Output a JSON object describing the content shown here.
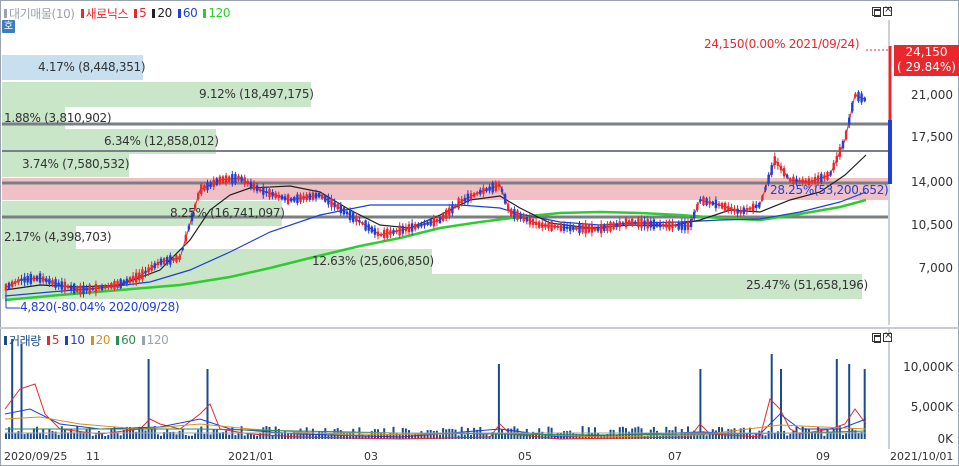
{
  "price_legend": {
    "items": [
      {
        "label": "대기매물(10)",
        "color": "#9aa3ad"
      },
      {
        "label": "새로닉스",
        "color": "#e8282c"
      },
      {
        "label": "5",
        "color": "#e8282c"
      },
      {
        "label": "20",
        "color": "#222222"
      },
      {
        "label": "60",
        "color": "#1f3fd6"
      },
      {
        "label": "120",
        "color": "#2ecc2e"
      }
    ]
  },
  "volume_legend": {
    "items": [
      {
        "label": "거래량",
        "color": "#1b4b8a"
      },
      {
        "label": "5",
        "color": "#e8282c"
      },
      {
        "label": "10",
        "color": "#1f3fd6"
      },
      {
        "label": "20",
        "color": "#d89020"
      },
      {
        "label": "60",
        "color": "#2e8b57"
      },
      {
        "label": "120",
        "color": "#9aa3ad"
      }
    ]
  },
  "badge": "호",
  "current_price": {
    "value": "24,150",
    "change": "( 29.84%)"
  },
  "high_annotation": "24,150(0.00% 2021/09/24)",
  "low_annotation": "4,820(-80.04% 2020/09/28)",
  "mid_annotation": "28.25%(53,200,652)",
  "price_axis": [
    "24,150",
    "21,000",
    "17,500",
    "14,000",
    "10,500",
    "7,000"
  ],
  "volume_axis": [
    "10,000K",
    "5,000K",
    "0K"
  ],
  "date_axis": [
    "2020/09/25",
    "11",
    "2021/01",
    "03",
    "05",
    "07",
    "09",
    "2021/10/01"
  ],
  "volume_profile": [
    {
      "label": "4.17% (8,448,351)"
    },
    {
      "label": "9.12% (18,497,175)"
    },
    {
      "label": "1.88% (3,810,902)"
    },
    {
      "label": "6.34% (12,858,012)"
    },
    {
      "label": "3.74% (7,580,532)"
    },
    {
      "label": "8.25% (16,741,097)"
    },
    {
      "label": "2.17% (4,398,703)"
    },
    {
      "label": "12.63% (25,606,850)"
    },
    {
      "label": "25.47% (51,658,196)"
    }
  ],
  "colors": {
    "up": "#e8282c",
    "down": "#1f3fd6",
    "profile_fill": "#c9e6c9",
    "profile_top": "#c8dff0",
    "highlight_band": "#f0c0c4",
    "ma5": "#e8282c",
    "ma20": "#222222",
    "ma60": "#1f3fd6",
    "ma120": "#2ecc2e",
    "volume_bar": "#1b4b8a"
  }
}
